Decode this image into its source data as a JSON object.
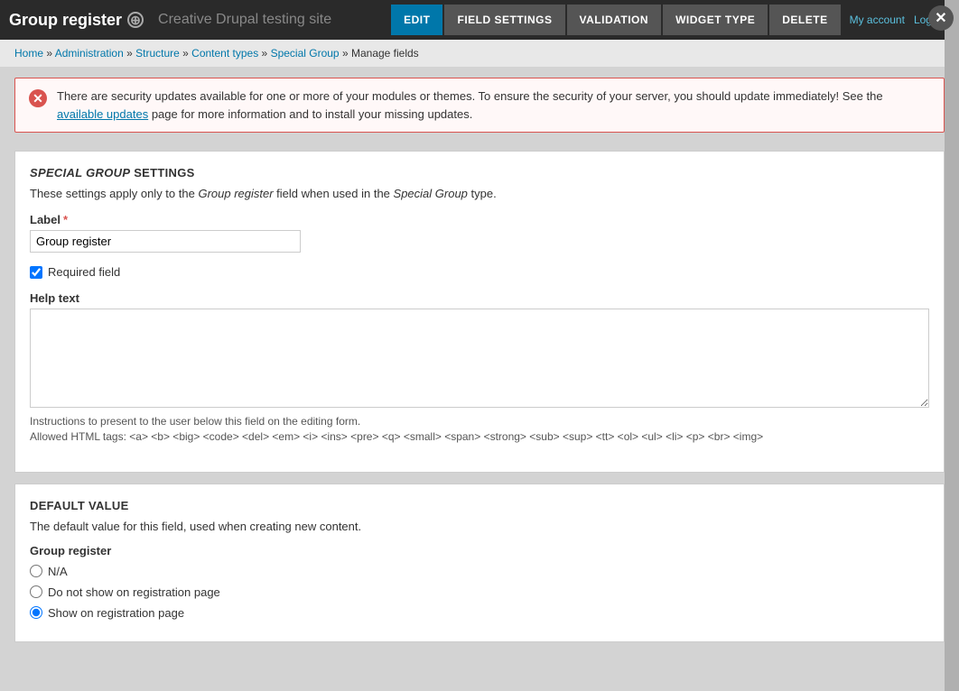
{
  "topbar": {
    "title": "Group register",
    "plus_icon": "+",
    "site_name": "Creative Drupal testing site",
    "tabs": [
      {
        "id": "edit",
        "label": "EDIT",
        "active": true
      },
      {
        "id": "field-settings",
        "label": "FIELD SETTINGS",
        "active": false
      },
      {
        "id": "validation",
        "label": "VALIDATION",
        "active": false
      },
      {
        "id": "widget-type",
        "label": "WIDGET TYPE",
        "active": false
      },
      {
        "id": "delete",
        "label": "DELETE",
        "active": false
      }
    ],
    "user_links": {
      "my_account": "My account",
      "log_out": "Log out"
    }
  },
  "breadcrumb": {
    "items": [
      {
        "label": "Home",
        "href": "#"
      },
      {
        "label": "Administration",
        "href": "#"
      },
      {
        "label": "Structure",
        "href": "#"
      },
      {
        "label": "Content types",
        "href": "#"
      },
      {
        "label": "Special Group",
        "href": "#"
      },
      {
        "label": "Manage fields",
        "href": "#"
      }
    ]
  },
  "alert": {
    "message": "There are security updates available for one or more of your modules or themes. To ensure the security of your server, you should update immediately! See the ",
    "link_text": "available updates",
    "message2": " page for more information and to install your missing updates."
  },
  "settings": {
    "section_title_italic": "SPECIAL GROUP",
    "section_title_rest": " SETTINGS",
    "description_pre": "These settings apply only to the ",
    "description_field": "Group register",
    "description_mid": " field when used in the ",
    "description_type": "Special Group",
    "description_post": " type.",
    "label_field": {
      "label": "Label",
      "required": true,
      "value": "Group register"
    },
    "required_field_checkbox": {
      "label": "Required field",
      "checked": true
    },
    "help_text": {
      "label": "Help text",
      "value": "",
      "hint_line1": "Instructions to present to the user below this field on the editing form.",
      "hint_line2": "Allowed HTML tags: <a> <b> <big> <code> <del> <em> <i> <ins> <pre> <q> <small> <span> <strong> <sub> <sup> <tt> <ol> <ul> <li> <p> <br> <img>"
    }
  },
  "default_value": {
    "title": "DEFAULT VALUE",
    "description": "The default value for this field, used when creating new content.",
    "field_group_title": "Group register",
    "options": [
      {
        "id": "na",
        "label": "N/A",
        "checked": false
      },
      {
        "id": "do-not-show",
        "label": "Do not show on registration page",
        "checked": false
      },
      {
        "id": "show",
        "label": "Show on registration page",
        "checked": true
      }
    ]
  }
}
